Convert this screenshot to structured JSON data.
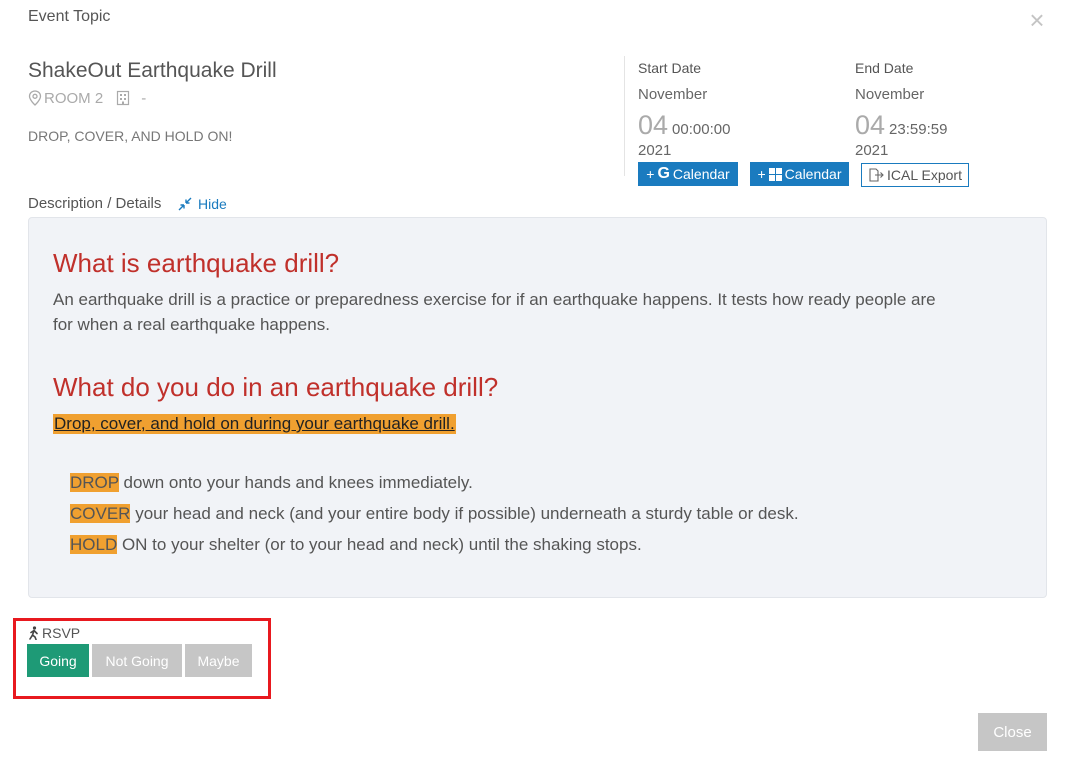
{
  "modal": {
    "title": "Event Topic",
    "close_icon": "×"
  },
  "event": {
    "name": "ShakeOut Earthquake Drill",
    "room": "ROOM 2",
    "building": "-",
    "subtitle": "DROP, COVER, AND HOLD ON!"
  },
  "start": {
    "label": "Start Date",
    "month": "November",
    "day": "04",
    "time": "00:00:00",
    "year": "2021"
  },
  "end": {
    "label": "End Date",
    "month": "November",
    "day": "04",
    "time": "23:59:59",
    "year": "2021"
  },
  "calendar_buttons": {
    "google_plus": "+",
    "google_g": "G",
    "google_label": "Calendar",
    "outlook_plus": "+",
    "outlook_label": "Calendar",
    "ical_label": "ICAL Export"
  },
  "description": {
    "label": "Description / Details",
    "toggle": "Hide",
    "heading1": "What is earthquake drill?",
    "para1_line1": "An earthquake drill is a practice or preparedness exercise for if an earthquake happens. It tests how ready people are",
    "para1_line2": "for when a real earthquake happens.",
    "heading2": "What do you do in an earthquake drill?",
    "highlight_link": "Drop, cover, and hold on during your earthquake drill.",
    "steps": [
      {
        "keyword": "DROP",
        "text": " down onto your hands and knees immediately."
      },
      {
        "keyword": "COVER",
        "text": " your head and neck (and your entire body if possible) underneath a sturdy table or desk."
      },
      {
        "keyword": "HOLD",
        "text": " ON to your shelter (or to your head and neck) until the shaking stops."
      }
    ]
  },
  "rsvp": {
    "label": "RSVP",
    "going": "Going",
    "not_going": "Not Going",
    "maybe": "Maybe",
    "selected": "Going"
  },
  "footer": {
    "close": "Close"
  },
  "colors": {
    "accent_blue": "#1a7bbf",
    "heading_red": "#c0302b",
    "highlight_orange": "#f0a030",
    "going_green": "#1e9a76",
    "inactive_gray": "#c6c6c6",
    "callout_red": "#e8191f"
  }
}
